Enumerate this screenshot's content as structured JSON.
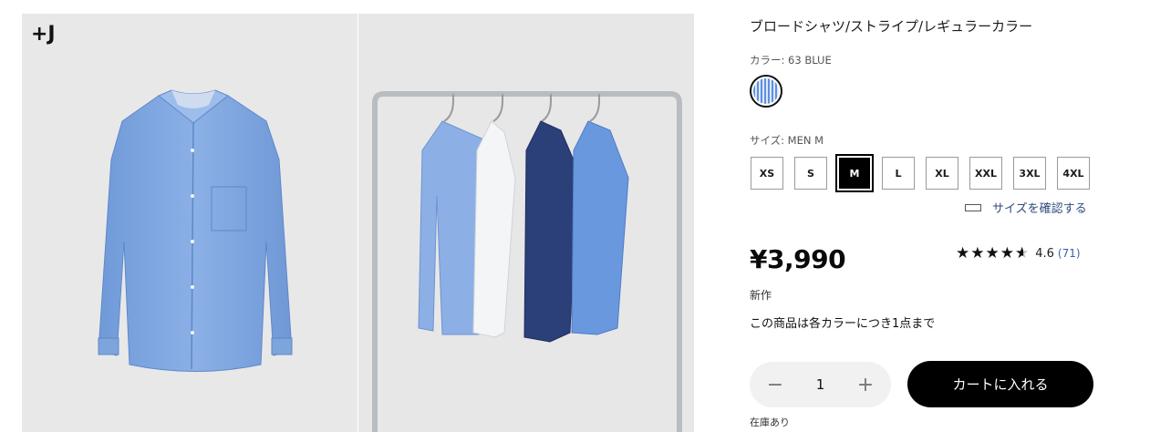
{
  "gallery": {
    "brand_mark": "+J"
  },
  "product": {
    "title": "ブロードシャツ/ストライプ/レギュラーカラー",
    "color_label": "カラー: 63 BLUE",
    "size_label": "サイズ: MEN M",
    "sizes": [
      "XS",
      "S",
      "M",
      "L",
      "XL",
      "XXL",
      "3XL",
      "4XL"
    ],
    "selected_size": "M",
    "size_check_link": "サイズを確認する",
    "price": "¥3,990",
    "rating": {
      "stars": 4.6,
      "value": "4.6",
      "count": "(71)"
    },
    "badge": "新作",
    "purchase_limit": "この商品は各カラーにつき1点まで",
    "quantity": "1",
    "add_to_cart": "カートに入れる",
    "stock": "在庫あり"
  },
  "colors": {
    "shirt_blue": "#7fa6df",
    "accent_black": "#000000"
  }
}
